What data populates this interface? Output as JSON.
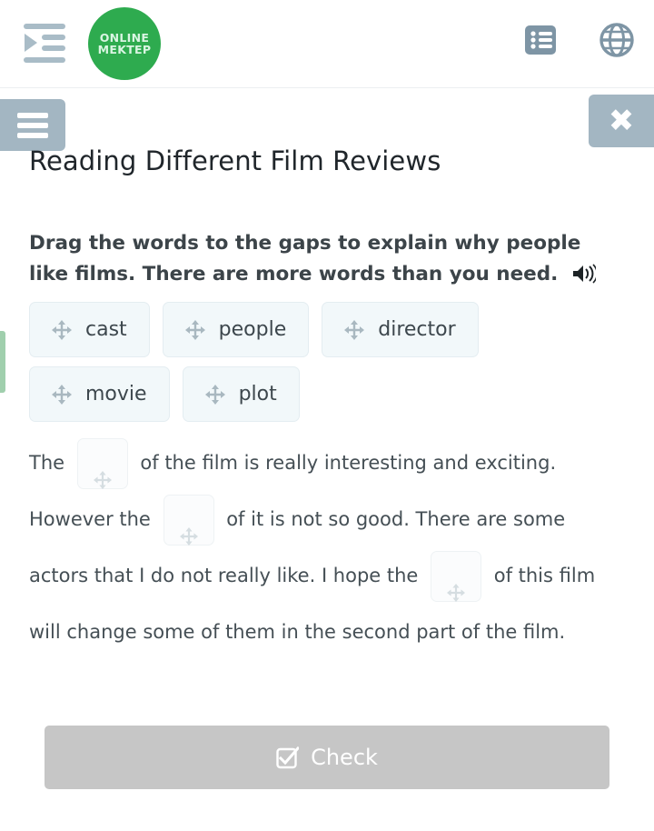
{
  "header": {
    "sidebar_toggle_icon": "indent-sidebar-icon",
    "logo": {
      "line1": "ONLINE",
      "line2": "MEKTEP",
      "color": "#2eab4f"
    },
    "list_icon": "list-view-icon",
    "globe_icon": "globe-language-icon"
  },
  "toolbar": {
    "menu_icon": "hamburger-menu-icon",
    "close_label": "✖",
    "close_icon": "close-x-icon",
    "accent_color": "#a3b6c2"
  },
  "lesson": {
    "title": "Reading Different Film Reviews",
    "instruction": "Drag the words to the gaps to explain why people like films. There are more words than you need.",
    "audio_icon": "speaker-audio-icon"
  },
  "word_bank": {
    "drag_icon": "move-arrows-icon",
    "words": [
      {
        "label": "cast"
      },
      {
        "label": "people"
      },
      {
        "label": "director"
      },
      {
        "label": "movie"
      },
      {
        "label": "plot"
      }
    ]
  },
  "exercise": {
    "gap_icon": "move-arrows-icon",
    "segments": [
      {
        "type": "text",
        "value": "The "
      },
      {
        "type": "gap",
        "index": 1,
        "value": ""
      },
      {
        "type": "text",
        "value": " of the film is really interesting and exciting. However the "
      },
      {
        "type": "gap",
        "index": 2,
        "value": ""
      },
      {
        "type": "text",
        "value": " of it is not so good. There are some actors that I do not really like. I hope the "
      },
      {
        "type": "gap",
        "index": 3,
        "value": ""
      },
      {
        "type": "text",
        "value": " of this film will change some of them in the second part of the film."
      }
    ]
  },
  "footer": {
    "check_label": "Check",
    "check_icon": "checkbox-checked-icon",
    "check_enabled": false,
    "check_color": "#c6c6c6"
  }
}
